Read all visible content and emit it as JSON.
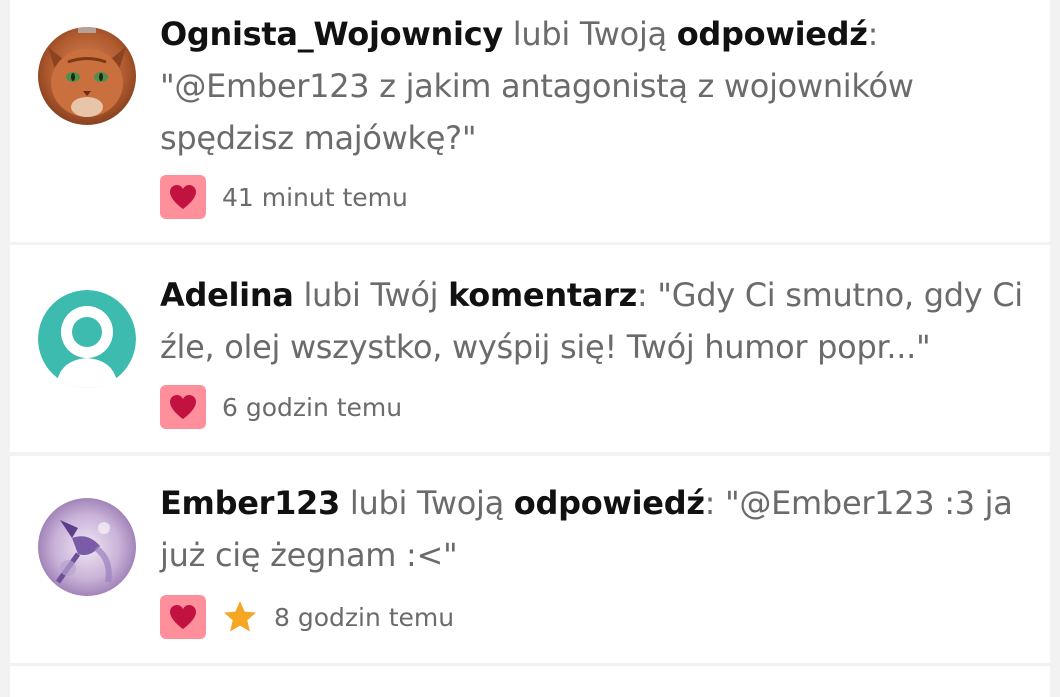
{
  "notifications": [
    {
      "user": "Ognista_Wojownicy",
      "action": " lubi Twoją ",
      "target": "odpowiedź",
      "sep": ": ",
      "quote": "\"@Ember123 z jakim antagonistą z wojowników spędzisz majówkę?\"",
      "time": "41 minut temu",
      "avatar": "cat-photo-avatar"
    },
    {
      "user": "Adelina",
      "action": " lubi Twój ",
      "target": "komentarz",
      "sep": ": ",
      "quote": "\"Gdy Ci smutno, gdy Ci źle, olej wszystko, wyśpij się! Twój humor popr...\"",
      "time": "6 godzin temu",
      "avatar": "default-user-avatar"
    },
    {
      "user": "Ember123",
      "action": " lubi Twoją ",
      "target": "odpowiedź",
      "sep": ": ",
      "quote": "\"@Ember123 :3 ja już cię żegnam :<\"",
      "time": "8 godzin temu",
      "avatar": "purple-art-avatar"
    }
  ],
  "colors": {
    "like_badge": "#ff8f9b",
    "heart": "#c2123f",
    "star": "#f5a623",
    "default_avatar": "#3dbbae"
  },
  "icons": {
    "like": "heart-icon",
    "favorite": "star-icon"
  }
}
